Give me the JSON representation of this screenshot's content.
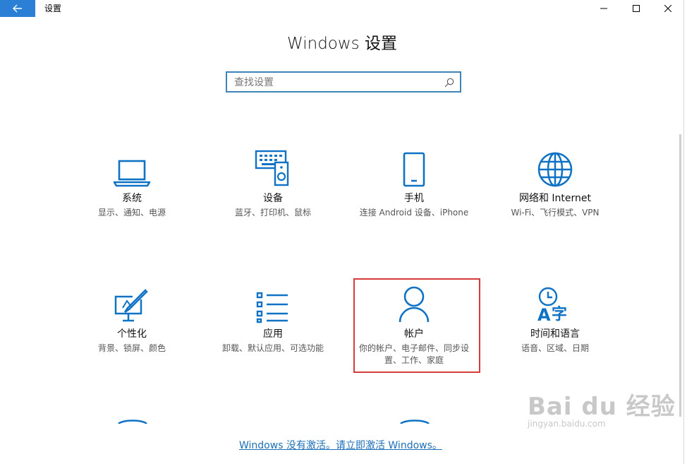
{
  "window": {
    "title": "设置",
    "controls": [
      "minimize-icon",
      "maximize-icon",
      "close-icon"
    ]
  },
  "page_title": "Windows 设置",
  "search": {
    "placeholder": "查找设置",
    "icon": "search-icon"
  },
  "tiles": [
    {
      "name": "系统",
      "desc": "显示、通知、电源",
      "icon": "laptop-icon"
    },
    {
      "name": "设备",
      "desc": "蓝牙、打印机、鼠标",
      "icon": "devices-icon"
    },
    {
      "name": "手机",
      "desc": "连接 Android 设备、iPhone",
      "icon": "phone-icon"
    },
    {
      "name": "网络和 Internet",
      "desc": "Wi-Fi、飞行模式、VPN",
      "icon": "globe-icon"
    },
    {
      "name": "个性化",
      "desc": "背景、锁屏、颜色",
      "icon": "personalization-icon"
    },
    {
      "name": "应用",
      "desc": "卸载、默认应用、可选功能",
      "icon": "apps-list-icon"
    },
    {
      "name": "帐户",
      "desc": "你的帐户、电子邮件、同步设置、工作、家庭",
      "icon": "person-icon"
    },
    {
      "name": "时间和语言",
      "desc": "语音、区域、日期",
      "icon": "time-language-icon"
    }
  ],
  "activation_link": "Windows 没有激活。请立即激活 Windows。",
  "watermark": {
    "brand": "Bai du 经验",
    "url": "jingyan.baidu.com"
  },
  "colors": {
    "accent": "#0f72c4",
    "titlebar_back": "#2b80d6",
    "highlight": "#d63b3b",
    "link": "#1e6fb8"
  }
}
